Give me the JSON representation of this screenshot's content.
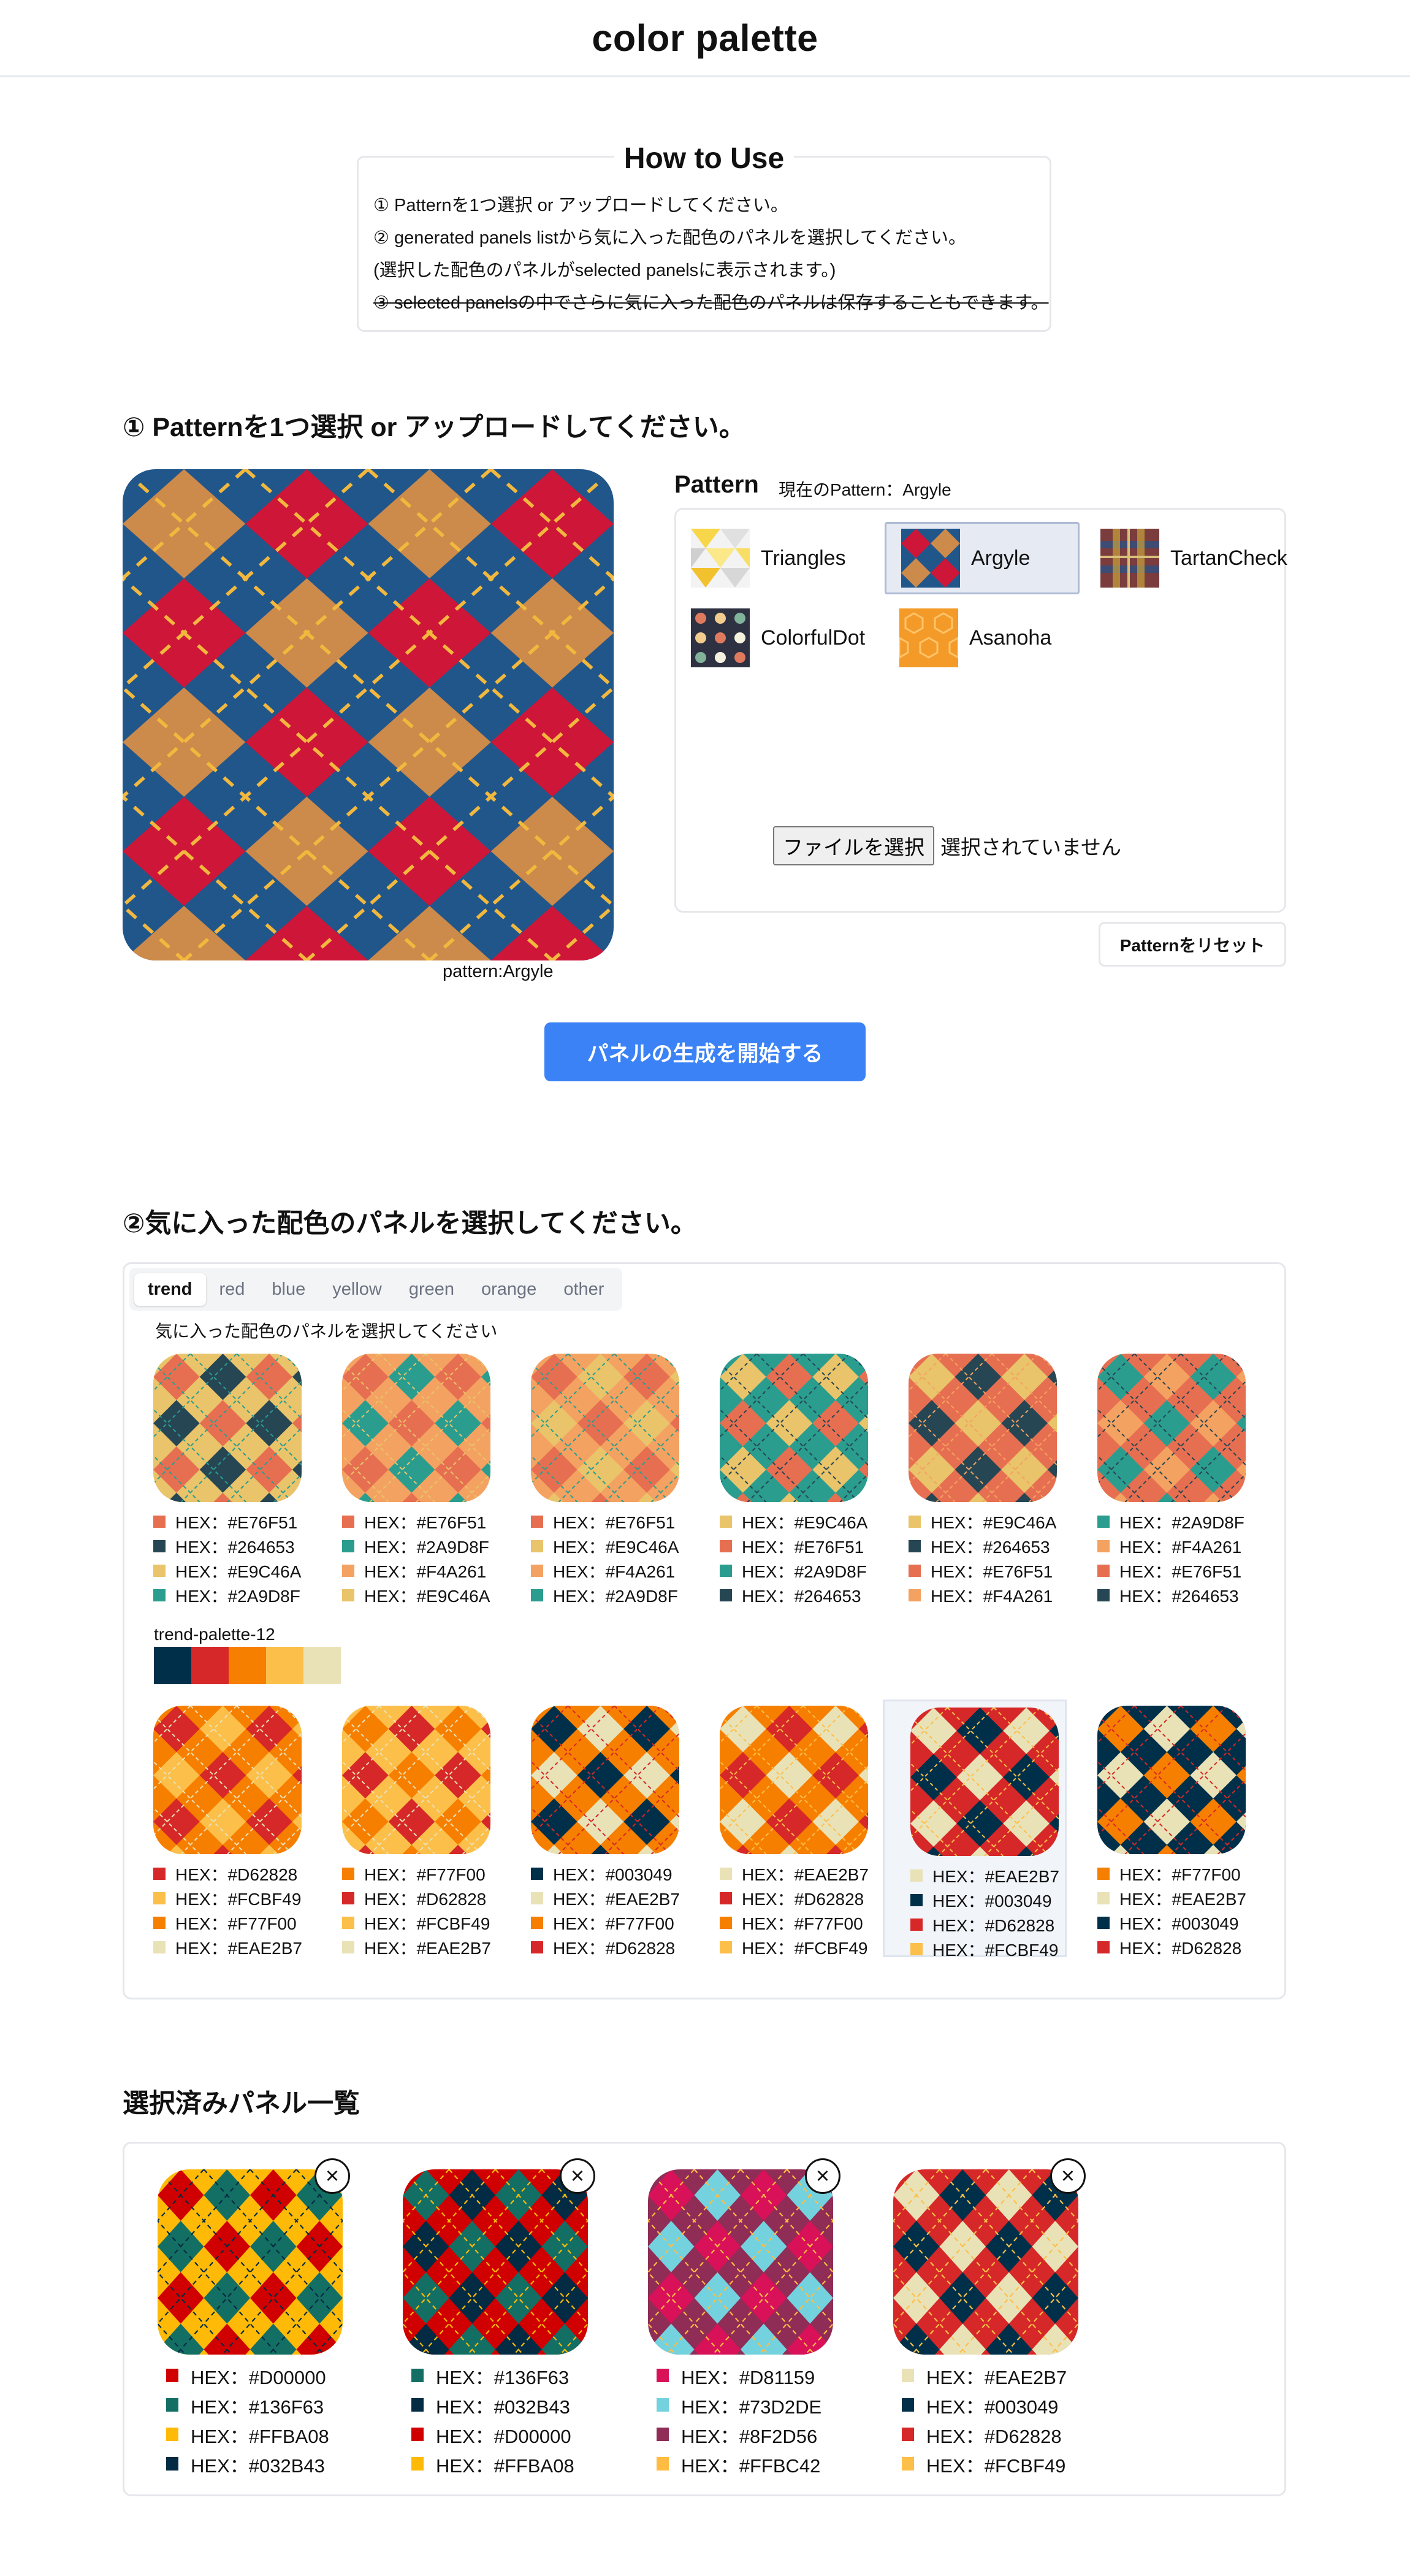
{
  "header": {
    "title": "color palette"
  },
  "how_to_use": {
    "title": "How to Use",
    "lines": [
      "① Patternを1つ選択 or アップロードしてください。",
      "② generated panels listから気に入った配色のパネルを選択してください。",
      "(選択した配色のパネルがselected panelsに表示されます。)",
      "③ selected panelsの中でさらに気に入った配色のパネルは保存することもできます。"
    ]
  },
  "step1": {
    "heading": "① Patternを1つ選択 or アップロードしてください。",
    "preview_caption": "pattern:Argyle",
    "pattern_label": "Pattern",
    "current_pattern": "現在のPattern：Argyle",
    "patterns": [
      {
        "name": "Triangles",
        "icon": "triangles-pattern-icon",
        "selected": false
      },
      {
        "name": "Argyle",
        "icon": "argyle-pattern-icon",
        "selected": true
      },
      {
        "name": "TartanCheck",
        "icon": "tartan-pattern-icon",
        "selected": false
      },
      {
        "name": "ColorfulDot",
        "icon": "dot-pattern-icon",
        "selected": false
      },
      {
        "name": "Asanoha",
        "icon": "asanoha-pattern-icon",
        "selected": false
      }
    ],
    "file_button": "ファイルを選択",
    "file_status": "選択されていません",
    "reset_button": "Patternをリセット",
    "start_button": "パネルの生成を開始する",
    "preview_colors": {
      "a": "#CC8A4B",
      "b": "#CE1638",
      "bg": "#21568A",
      "line": "#F2B83E"
    }
  },
  "step2": {
    "heading": "②気に入った配色のパネルを選択してください。",
    "tabs": [
      "trend",
      "red",
      "blue",
      "yellow",
      "green",
      "orange",
      "other"
    ],
    "active_tab": "trend",
    "hint": "気に入った配色のパネルを選択してください",
    "palette_name": "trend-palette-12",
    "palette_colors": [
      "#003049",
      "#D62828",
      "#F77F00",
      "#FCBF49",
      "#EAE2B7"
    ],
    "row1": [
      {
        "colors": [
          "#E76F51",
          "#264653",
          "#E9C46A",
          "#2A9D8F"
        ],
        "labels": [
          "HEX：#E76F51",
          "HEX：#264653",
          "HEX：#E9C46A",
          "HEX：#2A9D8F"
        ],
        "selected": false
      },
      {
        "colors": [
          "#E76F51",
          "#2A9D8F",
          "#F4A261",
          "#E9C46A"
        ],
        "labels": [
          "HEX：#E76F51",
          "HEX：#2A9D8F",
          "HEX：#F4A261",
          "HEX：#E9C46A"
        ],
        "selected": false
      },
      {
        "colors": [
          "#E76F51",
          "#E9C46A",
          "#F4A261",
          "#2A9D8F"
        ],
        "labels": [
          "HEX：#E76F51",
          "HEX：#E9C46A",
          "HEX：#F4A261",
          "HEX：#2A9D8F"
        ],
        "selected": false
      },
      {
        "colors": [
          "#E9C46A",
          "#E76F51",
          "#2A9D8F",
          "#264653"
        ],
        "labels": [
          "HEX：#E9C46A",
          "HEX：#E76F51",
          "HEX：#2A9D8F",
          "HEX：#264653"
        ],
        "selected": false
      },
      {
        "colors": [
          "#E9C46A",
          "#264653",
          "#E76F51",
          "#F4A261"
        ],
        "labels": [
          "HEX：#E9C46A",
          "HEX：#264653",
          "HEX：#E76F51",
          "HEX：#F4A261"
        ],
        "selected": false
      },
      {
        "colors": [
          "#2A9D8F",
          "#F4A261",
          "#E76F51",
          "#264653"
        ],
        "labels": [
          "HEX：#2A9D8F",
          "HEX：#F4A261",
          "HEX：#E76F51",
          "HEX：#264653"
        ],
        "selected": false
      }
    ],
    "row2": [
      {
        "colors": [
          "#D62828",
          "#FCBF49",
          "#F77F00",
          "#EAE2B7"
        ],
        "labels": [
          "HEX：#D62828",
          "HEX：#FCBF49",
          "HEX：#F77F00",
          "HEX：#EAE2B7"
        ],
        "selected": false
      },
      {
        "colors": [
          "#F77F00",
          "#D62828",
          "#FCBF49",
          "#EAE2B7"
        ],
        "labels": [
          "HEX：#F77F00",
          "HEX：#D62828",
          "HEX：#FCBF49",
          "HEX：#EAE2B7"
        ],
        "selected": false
      },
      {
        "colors": [
          "#003049",
          "#EAE2B7",
          "#F77F00",
          "#D62828"
        ],
        "labels": [
          "HEX：#003049",
          "HEX：#EAE2B7",
          "HEX：#F77F00",
          "HEX：#D62828"
        ],
        "selected": false
      },
      {
        "colors": [
          "#EAE2B7",
          "#D62828",
          "#F77F00",
          "#FCBF49"
        ],
        "labels": [
          "HEX：#EAE2B7",
          "HEX：#D62828",
          "HEX：#F77F00",
          "HEX：#FCBF49"
        ],
        "selected": false
      },
      {
        "colors": [
          "#EAE2B7",
          "#003049",
          "#D62828",
          "#FCBF49"
        ],
        "labels": [
          "HEX：#EAE2B7",
          "HEX：#003049",
          "HEX：#D62828",
          "HEX：#FCBF49"
        ],
        "selected": true
      },
      {
        "colors": [
          "#F77F00",
          "#EAE2B7",
          "#003049",
          "#D62828"
        ],
        "labels": [
          "HEX：#F77F00",
          "HEX：#EAE2B7",
          "HEX：#003049",
          "HEX：#D62828"
        ],
        "selected": false
      }
    ]
  },
  "selected_panels": {
    "heading": "選択済みパネル一覧",
    "close_icon": "×",
    "panels": [
      {
        "colors": [
          "#D00000",
          "#136F63",
          "#FFBA08",
          "#032B43"
        ],
        "labels": [
          "HEX：#D00000",
          "HEX：#136F63",
          "HEX：#FFBA08",
          "HEX：#032B43"
        ]
      },
      {
        "colors": [
          "#136F63",
          "#032B43",
          "#D00000",
          "#FFBA08"
        ],
        "labels": [
          "HEX：#136F63",
          "HEX：#032B43",
          "HEX：#D00000",
          "HEX：#FFBA08"
        ]
      },
      {
        "colors": [
          "#D81159",
          "#73D2DE",
          "#8F2D56",
          "#FFBC42"
        ],
        "labels": [
          "HEX：#D81159",
          "HEX：#73D2DE",
          "HEX：#8F2D56",
          "HEX：#FFBC42"
        ]
      },
      {
        "colors": [
          "#EAE2B7",
          "#003049",
          "#D62828",
          "#FCBF49"
        ],
        "labels": [
          "HEX：#EAE2B7",
          "HEX：#003049",
          "HEX：#D62828",
          "HEX：#FCBF49"
        ]
      }
    ]
  }
}
